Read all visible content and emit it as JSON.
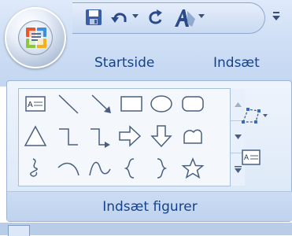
{
  "ribbon": {
    "tabs": [
      {
        "label": "Startside"
      },
      {
        "label": "Indsæt"
      }
    ],
    "group": {
      "label": "Indsæt figurer"
    }
  },
  "quick_access": {
    "items": [
      {
        "icon": "save-icon"
      },
      {
        "icon": "undo-icon"
      },
      {
        "icon": "redo-icon"
      },
      {
        "icon": "format-text-icon"
      },
      {
        "icon": "customize-toolbar-icon"
      }
    ]
  },
  "shapes": [
    "text-box",
    "line",
    "arrow",
    "rectangle",
    "oval",
    "rounded-rectangle",
    "triangle",
    "elbow-connector",
    "elbow-arrow-connector",
    "right-arrow",
    "down-arrow",
    "callout",
    "scribble",
    "arc",
    "curve",
    "left-brace",
    "right-brace",
    "star"
  ],
  "colors": {
    "ribbon_text": "#15428b",
    "ribbon_background": "#dfeafa",
    "orb_logo": [
      "#e8562a",
      "#f3b21c",
      "#8dc63f",
      "#3c8ee0"
    ]
  }
}
